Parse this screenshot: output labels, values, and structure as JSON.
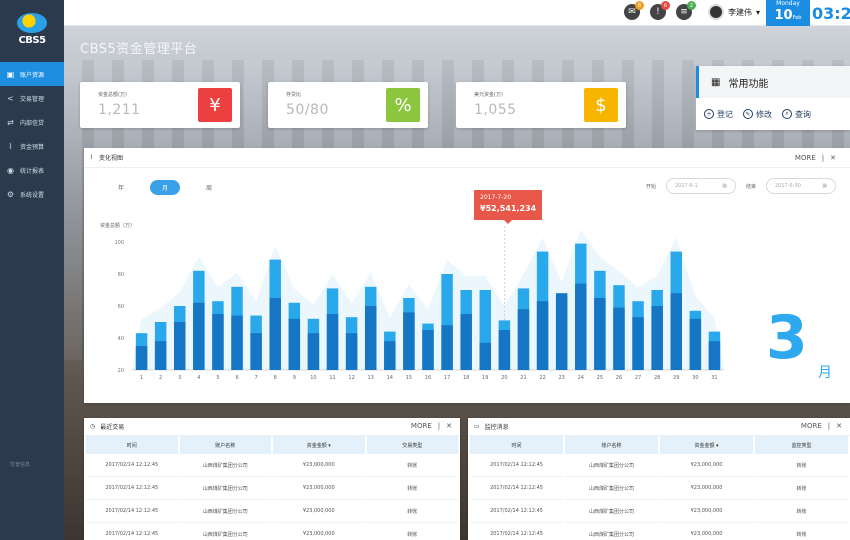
{
  "app": {
    "logo_text": "CBS5",
    "title": "CBS5资金管理平台"
  },
  "sidebar": {
    "items": [
      {
        "label": "账户资源",
        "icon": "user-card-icon",
        "active": true
      },
      {
        "label": "交易管理",
        "icon": "share-icon",
        "active": false
      },
      {
        "label": "内部信贷",
        "icon": "transfer-icon",
        "active": false
      },
      {
        "label": "资金预算",
        "icon": "chart-icon",
        "active": false
      },
      {
        "label": "统计报表",
        "icon": "globe-icon",
        "active": false
      },
      {
        "label": "系统设置",
        "icon": "gear-icon",
        "active": false
      }
    ],
    "footer": "优普信息"
  },
  "topbar": {
    "notifications": [
      {
        "icon": "message-icon",
        "badge": "8"
      },
      {
        "icon": "alert-icon",
        "badge": "6"
      },
      {
        "icon": "todo-icon",
        "badge": "2"
      }
    ],
    "user_name": "李建伟",
    "date": {
      "weekday": "Monday",
      "day": "10",
      "month": "Feb"
    },
    "time": "03:2"
  },
  "cards": [
    {
      "label": "资金总额(万)",
      "value": "1,211",
      "icon": "yen-icon",
      "symbol": "¥",
      "color": "#ec4040"
    },
    {
      "label": "存贷比",
      "value": "50/80",
      "icon": "percent-icon",
      "symbol": "%",
      "color": "#8cc63f"
    },
    {
      "label": "美元资金(万)",
      "value": "1,055",
      "icon": "dollar-icon",
      "symbol": "$",
      "color": "#f7b500"
    }
  ],
  "functions": {
    "title": "常用功能",
    "items": [
      {
        "label": "登记",
        "icon": "register-icon"
      },
      {
        "label": "修改",
        "icon": "edit-icon"
      },
      {
        "label": "查询",
        "icon": "search-doc-icon"
      }
    ]
  },
  "trend": {
    "title": "变化视图",
    "more": "MORE",
    "tabs": [
      {
        "label": "年",
        "active": false
      },
      {
        "label": "月",
        "active": true
      },
      {
        "label": "周",
        "active": false
      }
    ],
    "start_label": "开始",
    "start_date": "2017-6-1",
    "end_label": "结束",
    "end_date": "2017-6-30",
    "ylabel": "资金总额（万）",
    "tooltip_date": "2017-7-20",
    "tooltip_value": "¥52,541,234",
    "big_month": "3",
    "big_month_unit": "月"
  },
  "chart_data": {
    "type": "bar",
    "categories": [
      "1",
      "2",
      "3",
      "4",
      "5",
      "6",
      "7",
      "8",
      "9",
      "10",
      "11",
      "12",
      "13",
      "14",
      "15",
      "16",
      "17",
      "18",
      "19",
      "20",
      "21",
      "22",
      "23",
      "24",
      "25",
      "26",
      "27",
      "28",
      "29",
      "30",
      "31"
    ],
    "ylim": [
      20,
      100
    ],
    "yticks": [
      20,
      40,
      60,
      80,
      100
    ],
    "series": [
      {
        "values": [
          35,
          38,
          50,
          62,
          55,
          54,
          43,
          65,
          52,
          43,
          55,
          43,
          60,
          38,
          56,
          45,
          48,
          55,
          37,
          45,
          58,
          63,
          68,
          74,
          65,
          59,
          53,
          60,
          68,
          52,
          38
        ]
      },
      {
        "values": [
          43,
          50,
          60,
          82,
          63,
          72,
          54,
          89,
          62,
          52,
          71,
          53,
          72,
          44,
          65,
          49,
          80,
          70,
          70,
          51,
          71,
          94,
          66,
          99,
          82,
          73,
          63,
          70,
          94,
          57,
          44
        ]
      }
    ],
    "colors": [
      "#1576c6",
      "#29a8ec"
    ]
  },
  "recent": {
    "title": "最近交易",
    "more": "MORE",
    "columns": [
      "时间",
      "账户名称",
      "资金金额",
      "交易类型"
    ],
    "sort_icon": "sort-down-icon",
    "rows": [
      [
        "2017/02/14  12:12:45",
        "山西煤矿集团分公司",
        "¥23,000,000",
        "转账"
      ],
      [
        "2017/02/14  12:12:45",
        "山西煤矿集团分公司",
        "¥23,000,000",
        "转账"
      ],
      [
        "2017/02/14  12:12:45",
        "山西煤矿集团分公司",
        "¥23,000,000",
        "转账"
      ],
      [
        "2017/02/14  12:12:45",
        "山西煤矿集团分公司",
        "¥23,000,000",
        "转账"
      ]
    ]
  },
  "monitor": {
    "title": "监控消息",
    "more": "MORE",
    "columns": [
      "时间",
      "账户名称",
      "资金金额",
      "监控类型"
    ],
    "rows": [
      [
        "2017/02/14  12:12:45",
        "山西煤矿集团分公司",
        "¥23,000,000",
        "转账"
      ],
      [
        "2017/02/14  12:12:45",
        "山西煤矿集团分公司",
        "¥23,000,000",
        "转账"
      ],
      [
        "2017/02/14  12:12:45",
        "山西煤矿集团分公司",
        "¥23,000,000",
        "转账"
      ],
      [
        "2017/02/14  12:12:45",
        "山西煤矿集团分公司",
        "¥23,000,000",
        "转账"
      ]
    ]
  }
}
